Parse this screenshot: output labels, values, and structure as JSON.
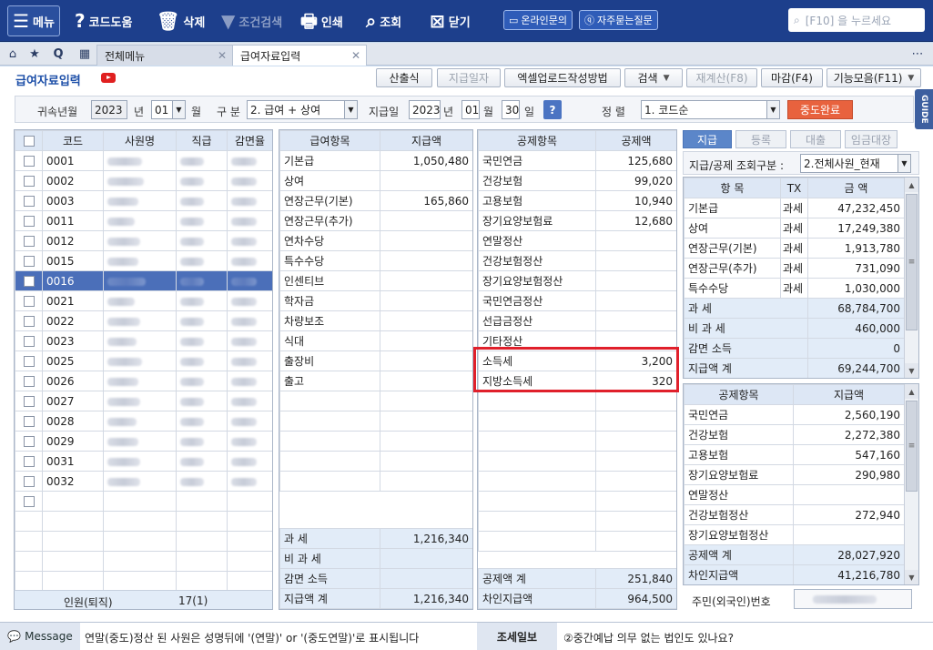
{
  "toolbar": {
    "menu": "메뉴",
    "help": "코드도움",
    "delete": "삭제",
    "cond_search": "조건검색",
    "print": "인쇄",
    "query": "조회",
    "close": "닫기",
    "online_inquiry": "온라인문의",
    "faq": "자주묻는질문",
    "search_placeholder": "[F10] 을 누르세요"
  },
  "tabs": {
    "all_menu": "전체메뉴",
    "current": "급여자료입력"
  },
  "page": {
    "title": "급여자료입력",
    "actions": {
      "calc": "산출식",
      "pay_date": "지급일자",
      "excel_upload": "엑셀업로드작성방법",
      "search": "검색",
      "recalc": "재계산(F8)",
      "deadline": "마감(F4)",
      "functions": "기능모음(F11)"
    },
    "guide": "GUIDE"
  },
  "filter": {
    "attr_label": "귀속년월",
    "year": "2023",
    "year_unit": "년",
    "month": "01",
    "month_unit": "월",
    "type_label": "구 분",
    "type_value": "2. 급여 + 상여",
    "pay_date_label": "지급일",
    "pay_year": "2023",
    "pay_month": "01",
    "pay_day": "30",
    "day_unit": "일",
    "help": "?",
    "sort_label": "정 렬",
    "sort_value": "1. 코드순",
    "complete": "중도완료"
  },
  "employees": {
    "headers": [
      "코드",
      "사원명",
      "직급",
      "감면율"
    ],
    "codes": [
      "0001",
      "0002",
      "0003",
      "0011",
      "0012",
      "0015",
      "0016",
      "0021",
      "0022",
      "0023",
      "0025",
      "0026",
      "0027",
      "0028",
      "0029",
      "0031",
      "0032"
    ],
    "selected": "0016",
    "footer_label": "인원(퇴직)",
    "footer_value": "17(1)"
  },
  "pay_items": {
    "headers": [
      "급여항목",
      "지급액"
    ],
    "rows": [
      {
        "name": "기본급",
        "amount": "1,050,480"
      },
      {
        "name": "상여",
        "amount": ""
      },
      {
        "name": "연장근무(기본)",
        "amount": "165,860"
      },
      {
        "name": "연장근무(추가)",
        "amount": ""
      },
      {
        "name": "연차수당",
        "amount": ""
      },
      {
        "name": "특수수당",
        "amount": ""
      },
      {
        "name": "인센티브",
        "amount": ""
      },
      {
        "name": "학자금",
        "amount": ""
      },
      {
        "name": "차량보조",
        "amount": ""
      },
      {
        "name": "식대",
        "amount": ""
      },
      {
        "name": "출장비",
        "amount": ""
      },
      {
        "name": "출고",
        "amount": ""
      }
    ],
    "summary": [
      {
        "name": "과 세",
        "amount": "1,216,340"
      },
      {
        "name": "비 과 세",
        "amount": ""
      },
      {
        "name": "감면 소득",
        "amount": ""
      },
      {
        "name": "지급액 계",
        "amount": "1,216,340"
      }
    ]
  },
  "deductions": {
    "headers": [
      "공제항목",
      "공제액"
    ],
    "rows": [
      {
        "name": "국민연금",
        "amount": "125,680"
      },
      {
        "name": "건강보험",
        "amount": "99,020"
      },
      {
        "name": "고용보험",
        "amount": "10,940"
      },
      {
        "name": "장기요양보험료",
        "amount": "12,680"
      },
      {
        "name": "연말정산",
        "amount": ""
      },
      {
        "name": "건강보험정산",
        "amount": ""
      },
      {
        "name": "장기요양보험정산",
        "amount": ""
      },
      {
        "name": "국민연금정산",
        "amount": ""
      },
      {
        "name": "선급금정산",
        "amount": ""
      },
      {
        "name": "기타정산",
        "amount": ""
      },
      {
        "name": "소득세",
        "amount": "3,200"
      },
      {
        "name": "지방소득세",
        "amount": "320"
      }
    ],
    "summary": [
      {
        "name": "공제액 계",
        "amount": "251,840"
      },
      {
        "name": "차인지급액",
        "amount": "964,500"
      }
    ]
  },
  "side": {
    "tabs": [
      "지급",
      "등록",
      "대출",
      "임금대장"
    ],
    "view_label": "지급/공제 조회구분 :",
    "view_value": "2.전체사원_현재",
    "pay_headers": [
      "항 목",
      "TX",
      "금 액"
    ],
    "pay_rows": [
      {
        "name": "기본급",
        "tx": "과세",
        "amount": "47,232,450"
      },
      {
        "name": "상여",
        "tx": "과세",
        "amount": "17,249,380"
      },
      {
        "name": "연장근무(기본)",
        "tx": "과세",
        "amount": "1,913,780"
      },
      {
        "name": "연장근무(추가)",
        "tx": "과세",
        "amount": "731,090"
      },
      {
        "name": "특수수당",
        "tx": "과세",
        "amount": "1,030,000"
      }
    ],
    "pay_summary": [
      {
        "name": "과 세",
        "amount": "68,784,700"
      },
      {
        "name": "비 과 세",
        "amount": "460,000"
      },
      {
        "name": "감면 소득",
        "amount": "0"
      },
      {
        "name": "지급액 계",
        "amount": "69,244,700"
      }
    ],
    "ded_headers": [
      "공제항목",
      "지급액"
    ],
    "ded_rows": [
      {
        "name": "국민연금",
        "amount": "2,560,190"
      },
      {
        "name": "건강보험",
        "amount": "2,272,380"
      },
      {
        "name": "고용보험",
        "amount": "547,160"
      },
      {
        "name": "장기요양보험료",
        "amount": "290,980"
      },
      {
        "name": "연말정산",
        "amount": ""
      },
      {
        "name": "건강보험정산",
        "amount": "272,940"
      },
      {
        "name": "장기요양보험정산",
        "amount": ""
      }
    ],
    "ded_summary": [
      {
        "name": "공제액 계",
        "amount": "28,027,920"
      },
      {
        "name": "차인지급액",
        "amount": "41,216,780"
      }
    ],
    "rrn_label": "주민(외국인)번호"
  },
  "status": {
    "message_label": "Message",
    "message": "연말(중도)정산 된 사원은 성명뒤에 '(연말)' or '(중도연말)'로 표시됩니다",
    "tax_label": "조세일보",
    "tax_text": "②중간예납 의무 없는 법인도 있나요?"
  },
  "colors": {
    "toolbar_bg": "#1d3f8c",
    "header_bg": "#dde7f5",
    "selected_row": "#4b6fb9",
    "highlight_border": "#e0202b",
    "complete_button": "#e8623e"
  }
}
